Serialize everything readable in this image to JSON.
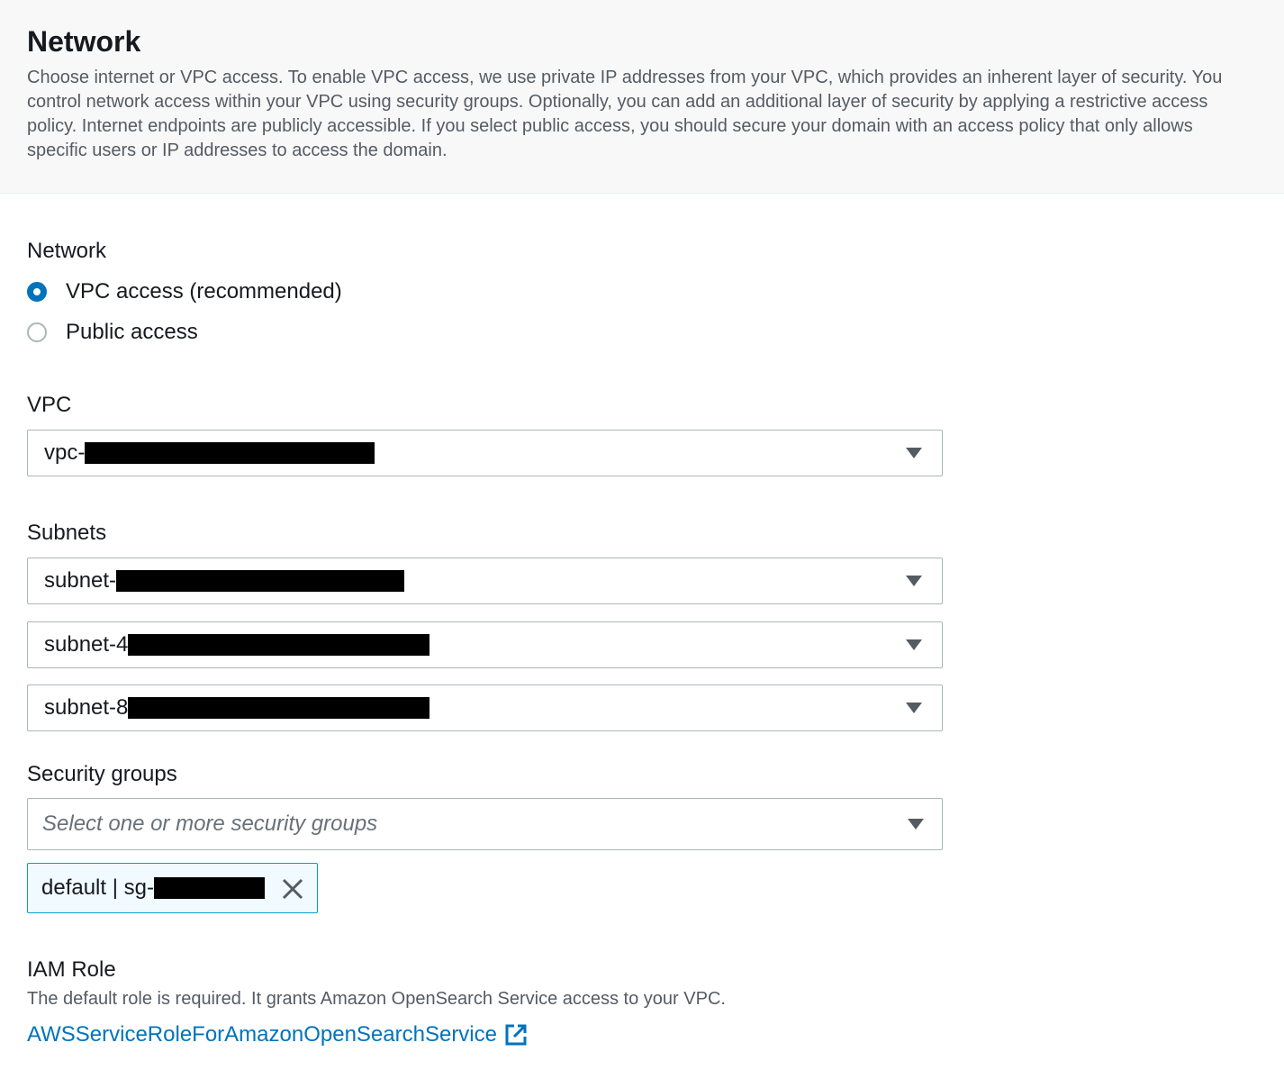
{
  "header": {
    "title": "Network",
    "description": "Choose internet or VPC access. To enable VPC access, we use private IP addresses from your VPC, which provides an inherent layer of security. You control network access within your VPC using security groups. Optionally, you can add an additional layer of security by applying a restrictive access policy. Internet endpoints are publicly accessible. If you select public access, you should secure your domain with an access policy that only allows specific users or IP addresses to access the domain."
  },
  "network": {
    "label": "Network",
    "options": [
      {
        "label": "VPC access (recommended)",
        "selected": true
      },
      {
        "label": "Public access",
        "selected": false
      }
    ]
  },
  "vpc": {
    "label": "VPC",
    "value_prefix": "vpc-"
  },
  "subnets": {
    "label": "Subnets",
    "items": [
      {
        "value_prefix": "subnet-"
      },
      {
        "value_prefix": "subnet-4"
      },
      {
        "value_prefix": "subnet-8"
      }
    ]
  },
  "security_groups": {
    "label": "Security groups",
    "placeholder": "Select one or more security groups",
    "token_prefix": "default | sg-"
  },
  "iam": {
    "label": "IAM Role",
    "hint": "The default role is required. It grants Amazon OpenSearch Service access to your VPC.",
    "link": "AWSServiceRoleForAmazonOpenSearchService"
  },
  "colors": {
    "accent": "#0073bb",
    "token_border": "#00a1c9",
    "token_bg": "#f1faff"
  },
  "icons": [
    "radio-checked",
    "radio-unchecked",
    "caret-down-icon",
    "close-icon",
    "external-link-icon"
  ]
}
